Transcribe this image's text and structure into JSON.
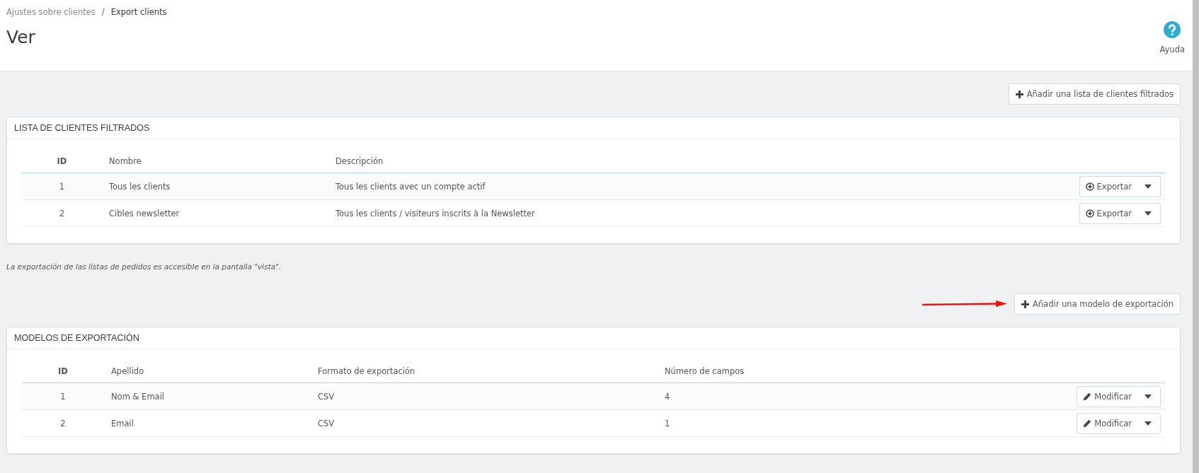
{
  "breadcrumb": [
    {
      "label": "Ajustes sobre clientes"
    },
    {
      "label": "Export clients"
    }
  ],
  "breadcrumb_separator": "/",
  "page_title": "Ver",
  "help_button": {
    "label": "Ayuda"
  },
  "sections": [
    {
      "add_button": "Añadir una lista de clientes filtrados",
      "annotated": false,
      "title": "LISTA DE CLIENTES FILTRADOS",
      "columns": [
        "ID",
        "Nombre",
        "Descripción"
      ],
      "rows": [
        {
          "cells": [
            "1",
            "Tous les clients",
            "Tous les clients avec un compte actif"
          ],
          "action": {
            "kind": "export",
            "label": "Exportar"
          }
        },
        {
          "cells": [
            "2",
            "Cibles newsletter",
            "Tous les clients / visiteurs inscrits à la Newsletter"
          ],
          "action": {
            "kind": "export",
            "label": "Exportar"
          }
        }
      ],
      "note": "La exportación de las listas de pedidos es accesible en la pantalla \"vista\"."
    },
    {
      "add_button": "Añadir una modelo de exportación",
      "annotated": true,
      "title": "MODELOS DE EXPORTACIÓN",
      "columns": [
        "ID",
        "Apellido",
        "Formato de exportación",
        "Número de campos"
      ],
      "rows": [
        {
          "cells": [
            "1",
            "Nom & Email",
            "CSV",
            "4"
          ],
          "action": {
            "kind": "edit",
            "label": "Modificar"
          }
        },
        {
          "cells": [
            "2",
            "Email",
            "CSV",
            "1"
          ],
          "action": {
            "kind": "edit",
            "label": "Modificar"
          }
        }
      ]
    }
  ]
}
